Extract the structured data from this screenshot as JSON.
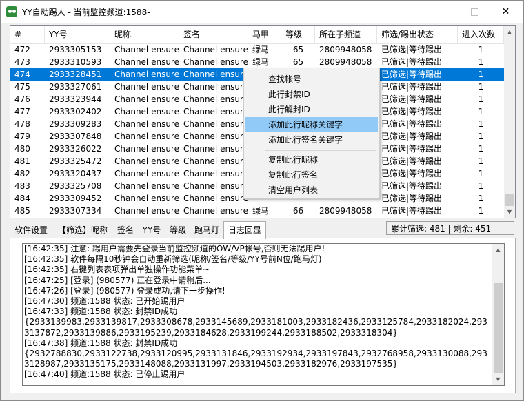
{
  "window": {
    "title": "YY自动踢人 - 当前监控频道:1588-",
    "minimize": "—",
    "maximize": "□",
    "close": "✕"
  },
  "table": {
    "columns": [
      "#",
      "YY号",
      "昵称",
      "签名",
      "马甲",
      "等级",
      "所在子频道",
      "筛选/踢出状态",
      "进入次数"
    ],
    "rows": [
      [
        "472",
        "2933305153",
        "Channel ensure",
        "Channel ensure",
        "绿马",
        "65",
        "2809948058",
        "已筛选|等待踢出",
        "1"
      ],
      [
        "473",
        "2933310593",
        "Channel ensure",
        "Channel ensure",
        "绿马",
        "65",
        "2809948058",
        "已筛选|等待踢出",
        "1"
      ],
      [
        "474",
        "2933328451",
        "Channel ensure",
        "Channel ensure",
        "",
        "",
        "",
        "已筛选|等待踢出",
        "1"
      ],
      [
        "475",
        "2933327061",
        "Channel ensure",
        "Channel ensure",
        "",
        "",
        "",
        "已筛选|等待踢出",
        "1"
      ],
      [
        "476",
        "2933323944",
        "Channel ensure",
        "Channel ensure",
        "",
        "",
        "",
        "已筛选|等待踢出",
        "1"
      ],
      [
        "477",
        "2933302402",
        "Channel ensure",
        "Channel ensure",
        "",
        "",
        "",
        "已筛选|等待踢出",
        "1"
      ],
      [
        "478",
        "2933309283",
        "Channel ensure",
        "Channel ensure",
        "",
        "",
        "",
        "已筛选|等待踢出",
        "1"
      ],
      [
        "479",
        "2933307848",
        "Channel ensure",
        "Channel ensure",
        "",
        "",
        "",
        "已筛选|等待踢出",
        "1"
      ],
      [
        "480",
        "2933326022",
        "Channel ensure",
        "Channel ensure",
        "",
        "",
        "",
        "已筛选|等待踢出",
        "1"
      ],
      [
        "481",
        "2933325472",
        "Channel ensure",
        "Channel ensure",
        "",
        "",
        "",
        "已筛选|等待踢出",
        "1"
      ],
      [
        "482",
        "2933320437",
        "Channel ensure",
        "Channel ensure",
        "",
        "",
        "",
        "已筛选|等待踢出",
        "1"
      ],
      [
        "483",
        "2933325708",
        "Channel ensure",
        "Channel ensure",
        "",
        "",
        "",
        "已筛选|等待踢出",
        "1"
      ],
      [
        "484",
        "2933309452",
        "Channel ensure",
        "Channel ensure",
        "",
        "",
        "",
        "已筛选|等待踢出",
        "1"
      ],
      [
        "485",
        "2933307334",
        "Channel ensure",
        "Channel ensure",
        "绿马",
        "66",
        "2809948058",
        "已筛选|等待踢出",
        "1"
      ]
    ],
    "selected_row": "474"
  },
  "context_menu": {
    "items": [
      "查找帐号",
      "此行封禁ID",
      "此行解封ID",
      "添加此行昵称关键字",
      "添加此行签名关键字",
      "复制此行昵称",
      "复制此行签名",
      "清空用户列表"
    ],
    "highlighted": "添加此行昵称关键字"
  },
  "tabs": {
    "items": [
      "软件设置",
      "【筛选】昵称",
      "签名",
      "YY号",
      "等级",
      "跑马灯",
      "日志回显"
    ],
    "active": "日志回显"
  },
  "counter": {
    "text": "累计筛选: 481 | 剩余: 451"
  },
  "log": {
    "text": "[16:42:35] 注意: 踢用户需要先登录当前监控频道的OW/VP帐号,否则无法踢用户!\n[16:42:35] 软件每隔10秒钟会自动重新筛选(昵称/签名/等级/YY号前N位/跑马灯)\n[16:42:35] 右键列表表项弹出单独操作功能菜单~\n[16:47:25] [登录] (980577) 正在登录中请稍后...\n[16:47:26] [登录] (980577) 登录成功,请下一步操作!\n[16:47:30] 频道:1588 状态: 已开始踢用户\n[16:47:33] 频道:1588 状态: 封禁ID成功\n{2933139983,2933139817,2933308678,2933145689,2933181003,2933182436,2933125784,2933182024,2933137872,2933139886,2933195239,2933184628,2933199244,2933188502,2933318304}\n[16:47:38] 频道:1588 状态: 封禁ID成功\n{2932788830,2933122738,2933120995,2933131846,2933192934,2933197843,2932768958,2933130088,2933128987,2933135175,2933148088,2933131997,2933194503,2933182976,2933197535}\n[16:47:40] 频道:1588 状态: 已停止踢用户"
  },
  "icons": {
    "app": "yy-app-icon",
    "scroll_up": "▲",
    "scroll_down": "▼"
  },
  "colors": {
    "selection": "#0078d7",
    "menu_highlight": "#91c9f7"
  }
}
